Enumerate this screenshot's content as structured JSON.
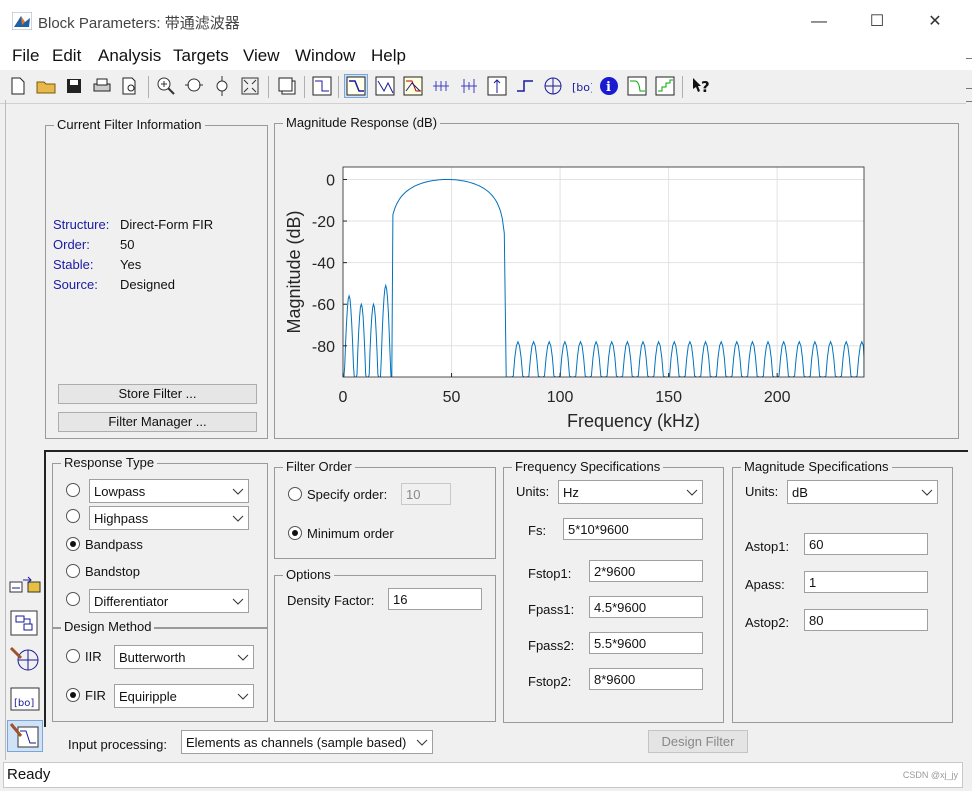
{
  "window": {
    "title": "Block Parameters: 带通滤波器",
    "min": "—",
    "max": "☐",
    "close": "✕"
  },
  "menu": [
    "File",
    "Edit",
    "Analysis",
    "Targets",
    "View",
    "Window",
    "Help"
  ],
  "current_filter": {
    "legend": "Current Filter Information",
    "structure_label": "Structure:",
    "structure": "Direct-Form FIR",
    "order_label": "Order:",
    "order": "50",
    "stable_label": "Stable:",
    "stable": "Yes",
    "source_label": "Source:",
    "source": "Designed",
    "store_button": "Store Filter ...",
    "manager_button": "Filter Manager ..."
  },
  "magnitude_panel": {
    "legend": "Magnitude Response (dB)"
  },
  "chart_data": {
    "type": "line",
    "title": "",
    "xlabel": "Frequency (kHz)",
    "ylabel": "Magnitude (dB)",
    "xlim": [
      0,
      240
    ],
    "ylim": [
      -95,
      6
    ],
    "xticks": [
      0,
      50,
      100,
      150,
      200
    ],
    "yticks": [
      0,
      -20,
      -40,
      -60,
      -80
    ],
    "grid": true,
    "series_color": "#0072bd",
    "passband": {
      "center": 48,
      "peak": 0,
      "edges": [
        23,
        77
      ]
    },
    "stopband1_lobes": [
      -56,
      -60,
      -60,
      -51
    ],
    "stopband2_lobe_level": -78
  },
  "response_type": {
    "legend": "Response Type",
    "options": [
      {
        "select": "Lowpass",
        "selected": false
      },
      {
        "select": "Highpass",
        "selected": false
      },
      {
        "label": "Bandpass",
        "selected": true
      },
      {
        "label": "Bandstop",
        "selected": false
      },
      {
        "select": "Differentiator",
        "selected": false
      }
    ]
  },
  "design_method": {
    "legend": "Design Method",
    "iir_label": "IIR",
    "iir_select": "Butterworth",
    "fir_label": "FIR",
    "fir_select": "Equiripple"
  },
  "filter_order": {
    "legend": "Filter Order",
    "specify_label": "Specify order:",
    "specify_value": "10",
    "minimum_label": "Minimum order"
  },
  "options": {
    "legend": "Options",
    "density_label": "Density Factor:",
    "density_value": "16"
  },
  "freq_specs": {
    "legend": "Frequency Specifications",
    "units_label": "Units:",
    "units": "Hz",
    "fs_label": "Fs:",
    "fs": "5*10*9600",
    "fstop1_label": "Fstop1:",
    "fstop1": "2*9600",
    "fpass1_label": "Fpass1:",
    "fpass1": "4.5*9600",
    "fpass2_label": "Fpass2:",
    "fpass2": "5.5*9600",
    "fstop2_label": "Fstop2:",
    "fstop2": "8*9600"
  },
  "mag_specs": {
    "legend": "Magnitude Specifications",
    "units_label": "Units:",
    "units": "dB",
    "astop1_label": "Astop1:",
    "astop1": "60",
    "apass_label": "Apass:",
    "apass": "1",
    "astop2_label": "Astop2:",
    "astop2": "80"
  },
  "input_processing": {
    "label": "Input processing:",
    "value": "Elements as channels (sample based)"
  },
  "design_button": "Design Filter",
  "status": "Ready",
  "watermark": "CSDN @xj_jy"
}
